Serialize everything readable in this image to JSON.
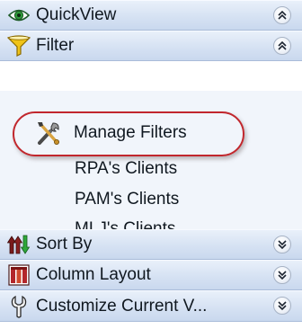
{
  "sections": {
    "quickview": {
      "label": "QuickView",
      "icon": "eye-icon",
      "state": "collapsed"
    },
    "filter": {
      "label": "Filter",
      "icon": "funnel-icon",
      "state": "expanded"
    },
    "sort_by": {
      "label": "Sort By",
      "icon": "sort-arrows-icon",
      "state": "collapsed"
    },
    "column_layout": {
      "label": "Column Layout",
      "icon": "columns-icon",
      "state": "collapsed"
    },
    "customize_view": {
      "label": "Customize Current V...",
      "icon": "wrench-icon",
      "state": "collapsed"
    }
  },
  "filter_items": {
    "manage": {
      "label": "Manage Filters",
      "icon": "tools-icon"
    },
    "rpa": {
      "label": "RPA's Clients"
    },
    "pam": {
      "label": "PAM's Clients"
    },
    "mlj": {
      "label": "MLJ's Clients"
    }
  },
  "colors": {
    "header_gradient_top": "#e9f0fa",
    "header_gradient_bottom": "#c9d8ee",
    "expanded_body": "#f1f5fb",
    "highlight_ring": "#c1272d"
  }
}
